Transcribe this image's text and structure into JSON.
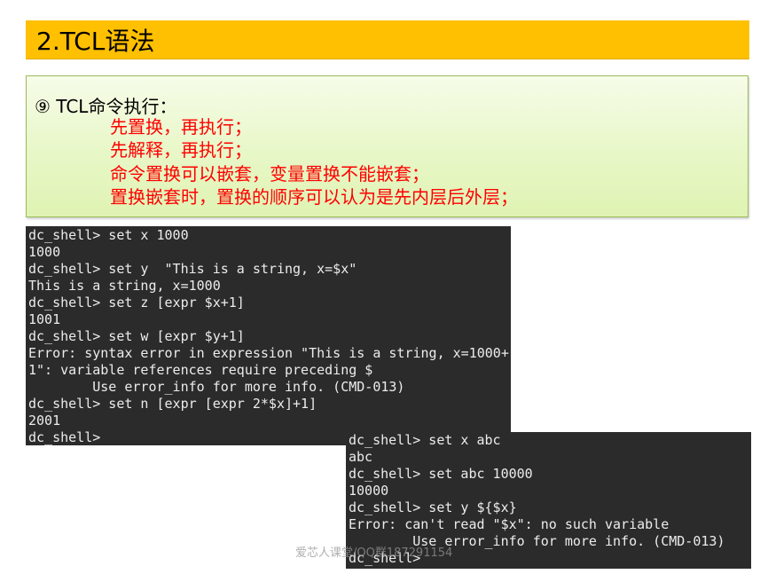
{
  "slide": {
    "title": "2.TCL语法"
  },
  "note": {
    "heading": "⑨ TCL命令执行：",
    "lines": [
      "先置换，再执行；",
      "先解释，再执行；",
      "命令置换可以嵌套，变量置换不能嵌套；",
      "置换嵌套时，置换的顺序可以认为是先内层后外层；"
    ],
    "line_color": "#ff0000"
  },
  "terminal_1": {
    "lines": [
      "dc_shell> set x 1000",
      "1000",
      "dc_shell> set y  \"This is a string, x=$x\"",
      "This is a string, x=1000",
      "dc_shell> set z [expr $x+1]",
      "1001",
      "dc_shell> set w [expr $y+1]",
      "Error: syntax error in expression \"This is a string, x=1000+",
      "1\": variable references require preceding $",
      "        Use error_info for more info. (CMD-013)",
      "dc_shell> set n [expr [expr 2*$x]+1]",
      "2001",
      "dc_shell>"
    ]
  },
  "terminal_2": {
    "lines": [
      "dc_shell> set x abc",
      "abc",
      "dc_shell> set abc 10000",
      "10000",
      "dc_shell> set y ${$x}",
      "Error: can't read \"$x\": no such variable",
      "        Use error_info for more info. (CMD-013)",
      "dc_shell>"
    ]
  },
  "watermark": "爱芯人课堂/QQ群187291154",
  "colors": {
    "title_bg": "#fec000",
    "terminal_bg": "#2b2b2b",
    "note_border": "#9bbb59"
  }
}
